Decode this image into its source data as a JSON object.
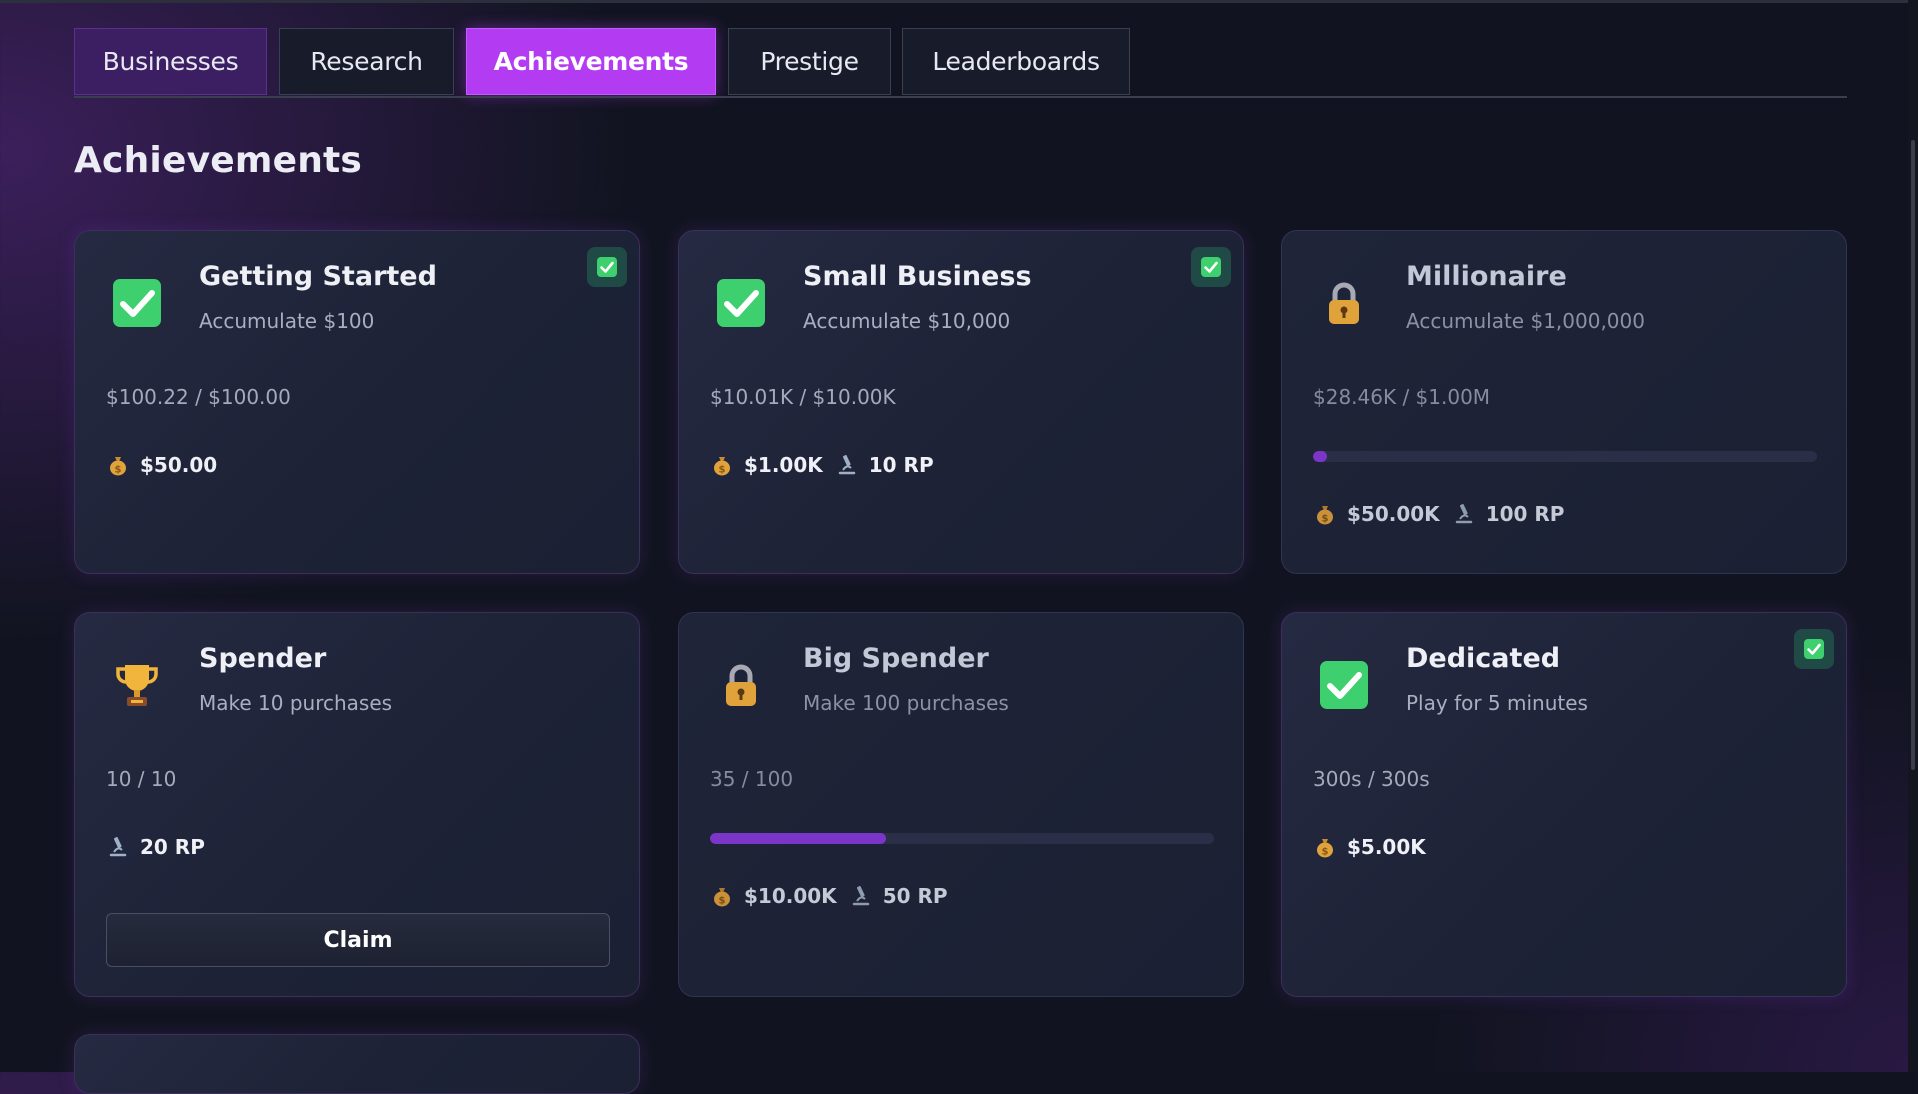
{
  "tabs": [
    {
      "label": "Businesses",
      "state": "highlight"
    },
    {
      "label": "Research",
      "state": "normal"
    },
    {
      "label": "Achievements",
      "state": "active"
    },
    {
      "label": "Prestige",
      "state": "normal"
    },
    {
      "label": "Leaderboards",
      "state": "normal"
    }
  ],
  "page": {
    "title": "Achievements"
  },
  "achievements": [
    {
      "title": "Getting Started",
      "desc": "Accumulate $100",
      "progress": "$100.22 / $100.00",
      "icon": "check-icon",
      "completed": true,
      "fraction": 1.0,
      "rewards": {
        "money": "$50.00"
      }
    },
    {
      "title": "Small Business",
      "desc": "Accumulate $10,000",
      "progress": "$10.01K / $10.00K",
      "icon": "check-icon",
      "completed": true,
      "fraction": 1.0,
      "rewards": {
        "money": "$1.00K",
        "rp": "10 RP"
      }
    },
    {
      "title": "Millionaire",
      "desc": "Accumulate $1,000,000",
      "progress": "$28.46K / $1.00M",
      "icon": "lock-icon",
      "completed": false,
      "fraction": 0.0285,
      "rewards": {
        "money": "$50.00K",
        "rp": "100 RP"
      }
    },
    {
      "title": "Spender",
      "desc": "Make 10 purchases",
      "progress": "10 / 10",
      "icon": "trophy-icon",
      "completed": false,
      "fraction": 1.0,
      "rewards": {
        "rp": "20 RP"
      },
      "claim_label": "Claim"
    },
    {
      "title": "Big Spender",
      "desc": "Make 100 purchases",
      "progress": "35 / 100",
      "icon": "lock-icon",
      "completed": false,
      "fraction": 0.35,
      "rewards": {
        "money": "$10.00K",
        "rp": "50 RP"
      }
    },
    {
      "title": "Dedicated",
      "desc": "Play for 5 minutes",
      "progress": "300s / 300s",
      "icon": "check-icon",
      "completed": true,
      "fraction": 1.0,
      "rewards": {
        "money": "$5.00K"
      }
    }
  ],
  "colors": {
    "accent": "#b33cf2",
    "progress_fill": "#7b35c8",
    "check_green": "#3ecf6e"
  }
}
